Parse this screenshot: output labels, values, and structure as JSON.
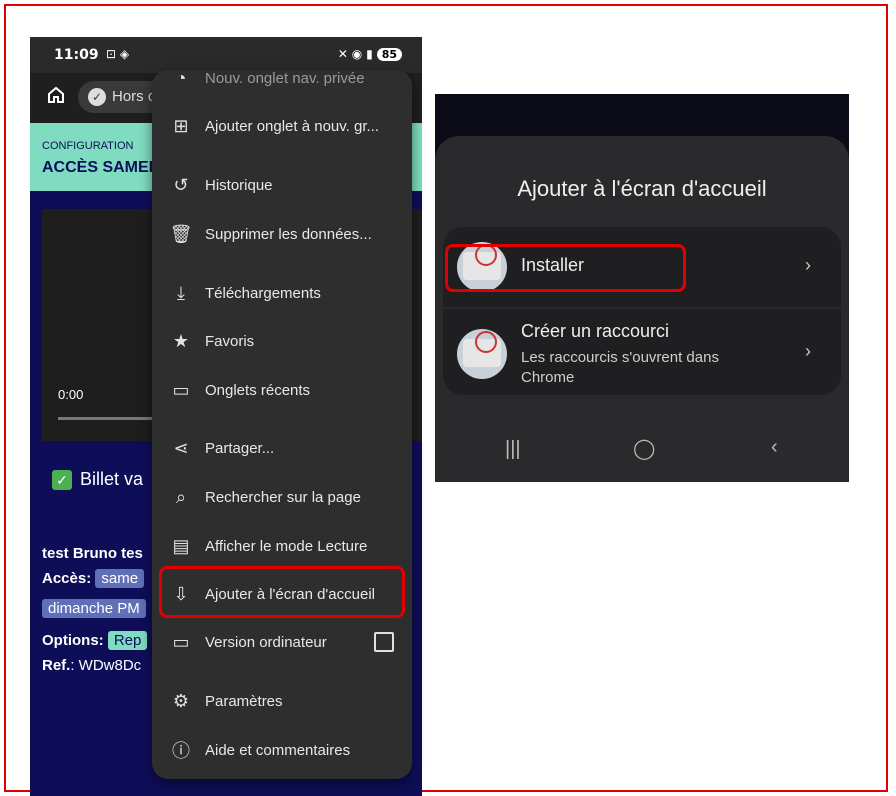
{
  "left_phone": {
    "status_time": "11:09",
    "status_extra": "⊡ ◈",
    "status_icons": "✕ ◉ ▮",
    "battery": "85",
    "url_label": "Hors c",
    "config_label": "CONFIGURATION",
    "config_title": "ACCÈS SAMEI",
    "video_time": "0:00",
    "billet_text": "Billet va",
    "info_name": "test Bruno tes",
    "info_acces_label": "Accès:",
    "info_acces_tag": "same",
    "info_dimanche_tag": "dimanche PM",
    "info_options_label": "Options:",
    "info_options_tag": "Rep",
    "info_ref_label": "Ref.",
    "info_ref_value": ": WDw8Dc"
  },
  "menu": {
    "items": [
      {
        "label": "Nouv. onglet nav. privée",
        "icon": "incognito-icon"
      },
      {
        "label": "Ajouter onglet à nouv. gr...",
        "icon": "tab-group-icon"
      },
      {
        "label": "Historique",
        "icon": "history-icon"
      },
      {
        "label": "Supprimer les données...",
        "icon": "trash-icon"
      },
      {
        "label": "Téléchargements",
        "icon": "download-icon"
      },
      {
        "label": "Favoris",
        "icon": "star-icon"
      },
      {
        "label": "Onglets récents",
        "icon": "devices-icon"
      },
      {
        "label": "Partager...",
        "icon": "share-icon"
      },
      {
        "label": "Rechercher sur la page",
        "icon": "find-in-page-icon"
      },
      {
        "label": "Afficher le mode Lecture",
        "icon": "reader-icon"
      },
      {
        "label": "Ajouter à l'écran d'accueil",
        "icon": "add-to-home-icon"
      },
      {
        "label": "Version ordinateur",
        "icon": "desktop-icon"
      },
      {
        "label": "Paramètres",
        "icon": "gear-icon"
      },
      {
        "label": "Aide et commentaires",
        "icon": "help-icon"
      }
    ]
  },
  "right_phone": {
    "title": "Ajouter à l'écran d'accueil",
    "install_label": "Installer",
    "shortcut_label": "Créer un raccourci",
    "shortcut_desc_line1": "Les raccourcis s'ouvrent dans",
    "shortcut_desc_line2": "Chrome"
  },
  "colors": {
    "highlight": "#e10000",
    "page_bg": "#0e0e58",
    "config_bg": "#7fdcc1",
    "menu_bg": "#2e2e2e"
  }
}
